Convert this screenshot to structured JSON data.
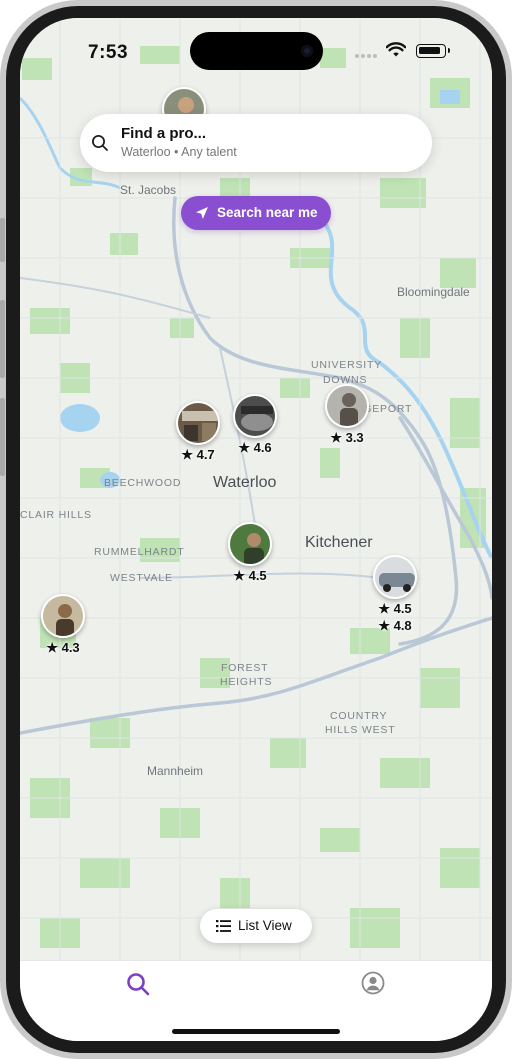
{
  "status_bar": {
    "time": "7:53"
  },
  "search": {
    "title": "Find a pro...",
    "subtitle": "Waterloo • Any talent"
  },
  "near_button": {
    "label": "Search near me"
  },
  "map_labels": {
    "st_jacobs": "St. Jacobs",
    "bloomingdale": "Bloomingdale",
    "university": "UNIVERSITY",
    "downs": "DOWNS",
    "bridgeport": "BRIDGEPORT",
    "beechwood": "BEECHWOOD",
    "waterloo": "Waterloo",
    "clair_hills": "CLAIR HILLS",
    "kitchener": "Kitchener",
    "rummelhardt": "RUMMELHARDT",
    "westvale": "WESTVALE",
    "forest": "FOREST",
    "heights": "HEIGHTS",
    "country": "COUNTRY",
    "hills_west": "HILLS WEST",
    "mannheim": "Mannheim"
  },
  "pros": [
    {
      "rating": "★ 4.7"
    },
    {
      "rating": "★ 4.6"
    },
    {
      "rating": "★ 3.3"
    },
    {
      "rating": "★ 4.5"
    },
    {
      "rating": "★ 4.5",
      "rating_second": "★ 4.8"
    },
    {
      "rating": "★ 4.3"
    }
  ],
  "list_view": {
    "label": "List View"
  },
  "tabs": [
    {
      "icon": "search-icon",
      "active": true
    },
    {
      "icon": "profile-icon",
      "active": false
    }
  ],
  "colors": {
    "accent": "#8a4fd1",
    "map_park": "#bfe3b4",
    "map_water": "#a6d3f0",
    "map_road": "#b9c7d6"
  }
}
